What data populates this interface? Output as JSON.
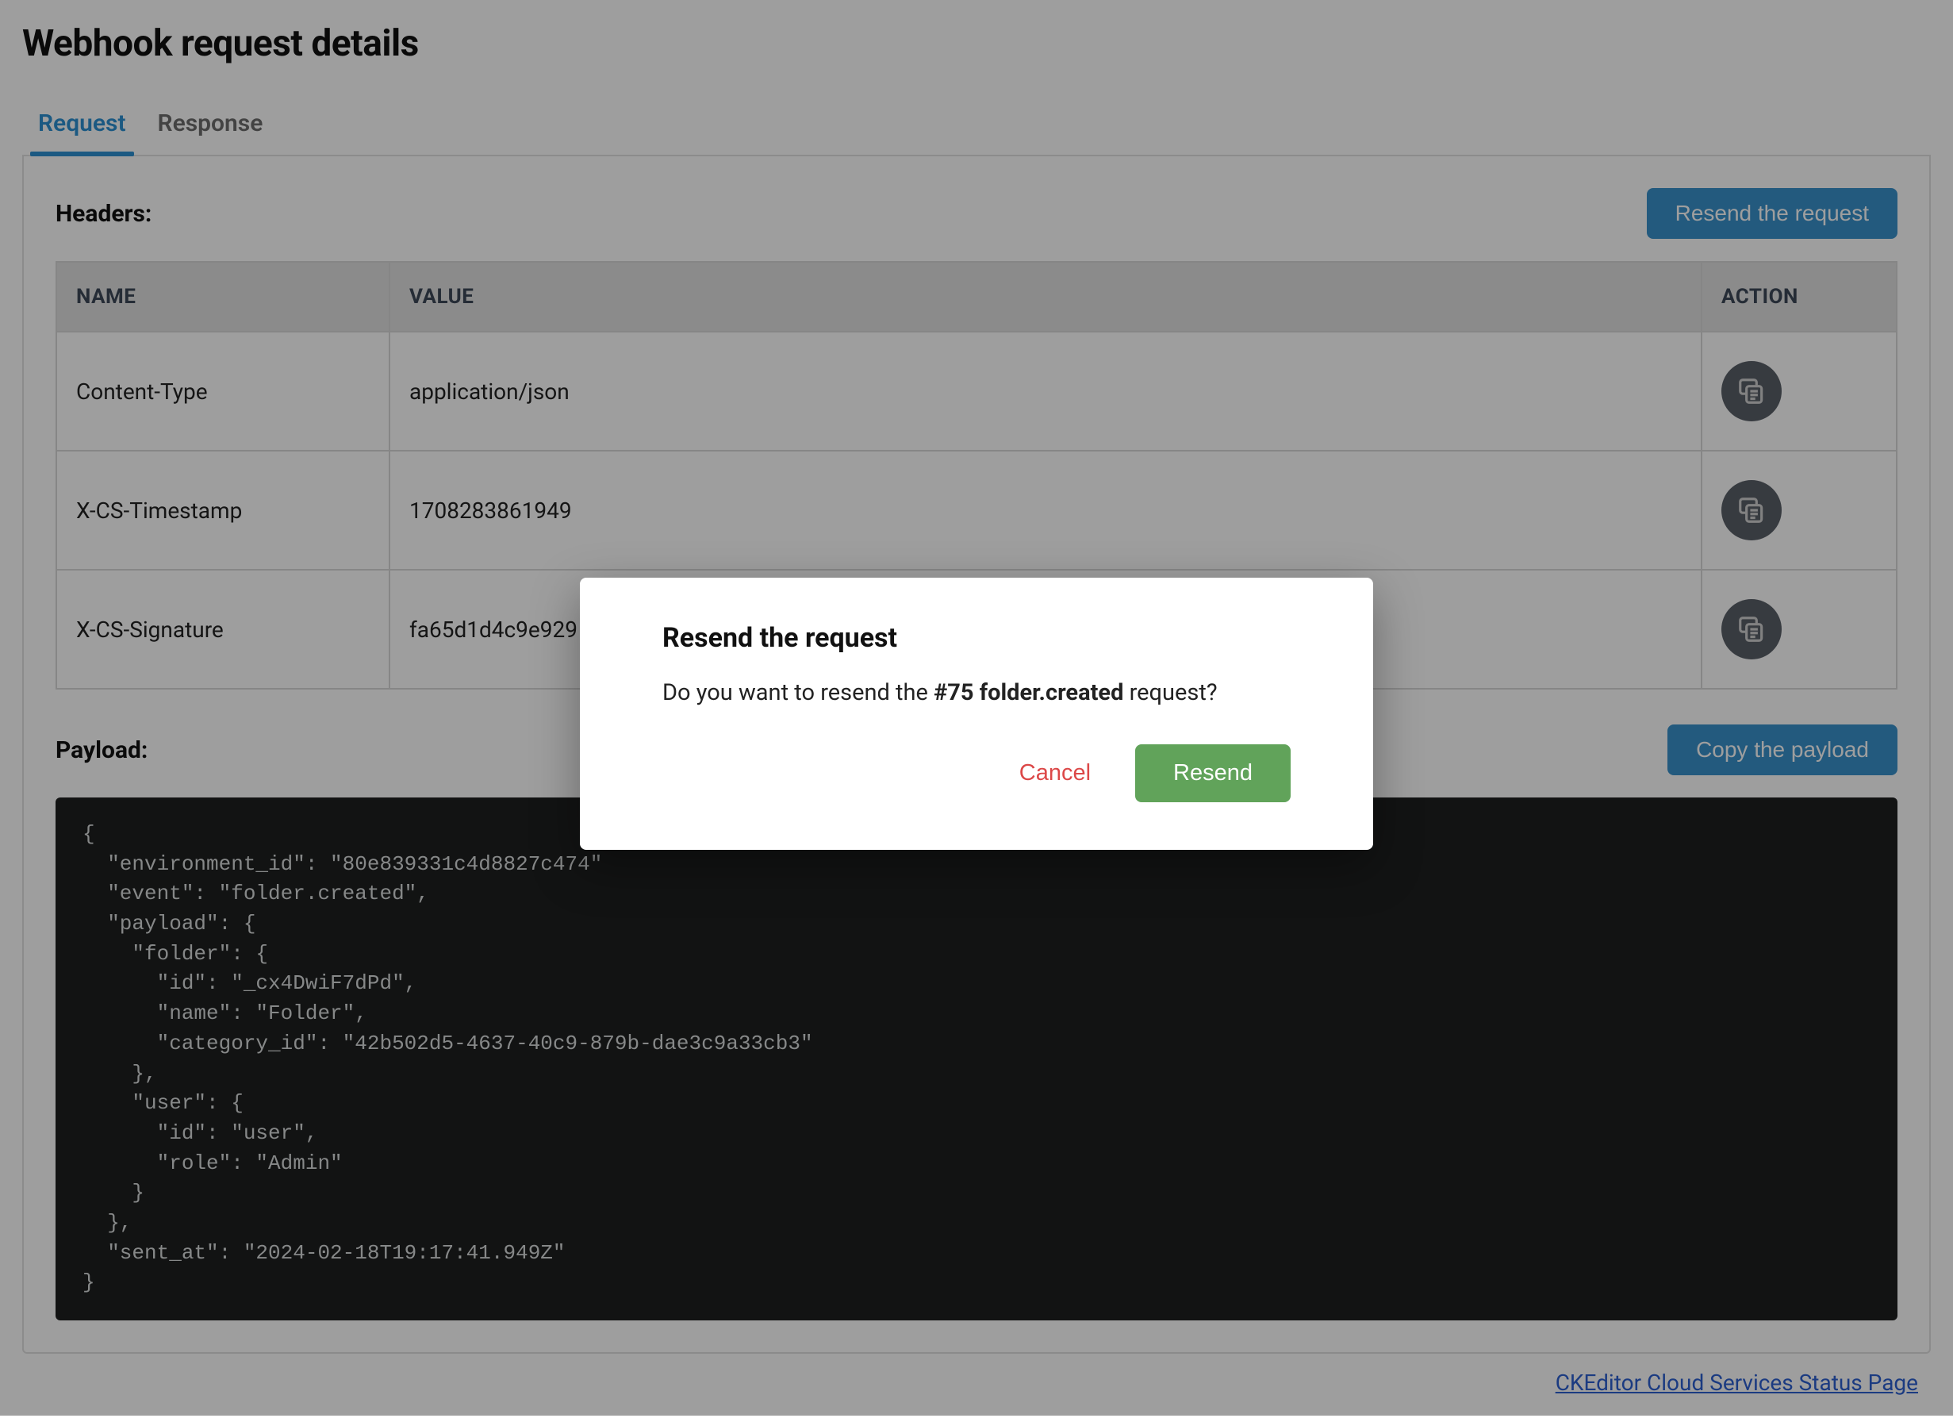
{
  "title": "Webhook request details",
  "tabs": {
    "request": "Request",
    "response": "Response"
  },
  "headers": {
    "label": "Headers:",
    "resend_btn": "Resend the request",
    "columns": {
      "name": "NAME",
      "value": "VALUE",
      "action": "ACTION"
    },
    "rows": [
      {
        "name": "Content-Type",
        "value": "application/json"
      },
      {
        "name": "X-CS-Timestamp",
        "value": "1708283861949"
      },
      {
        "name": "X-CS-Signature",
        "value": "fa65d1d4c9e929"
      }
    ]
  },
  "payload": {
    "label": "Payload:",
    "copy_btn": "Copy the payload",
    "body": "{\n  \"environment_id\": \"80e839331c4d8827c474\"\n  \"event\": \"folder.created\",\n  \"payload\": {\n    \"folder\": {\n      \"id\": \"_cx4DwiF7dPd\",\n      \"name\": \"Folder\",\n      \"category_id\": \"42b502d5-4637-40c9-879b-dae3c9a33cb3\"\n    },\n    \"user\": {\n      \"id\": \"user\",\n      \"role\": \"Admin\"\n    }\n  },\n  \"sent_at\": \"2024-02-18T19:17:41.949Z\"\n}"
  },
  "footer": {
    "status_link": "CKEditor Cloud Services Status Page"
  },
  "modal": {
    "title": "Resend the request",
    "prefix": "Do you want to resend the ",
    "bold": "#75 folder.created",
    "suffix": " request?",
    "cancel": "Cancel",
    "resend": "Resend"
  }
}
